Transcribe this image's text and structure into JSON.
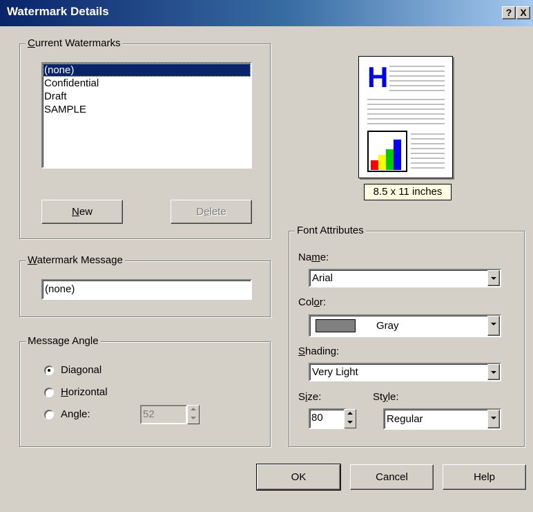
{
  "window": {
    "title": "Watermark Details",
    "help_btn": "?",
    "close_btn": "X"
  },
  "current_watermarks": {
    "legend": "Current Watermarks",
    "items": [
      "(none)",
      "Confidential",
      "Draft",
      "SAMPLE"
    ],
    "selected_index": 0,
    "new_button": "New",
    "delete_button": "Delete"
  },
  "watermark_message": {
    "legend": "Watermark Message",
    "value": "(none)"
  },
  "message_angle": {
    "legend": "Message Angle",
    "options": [
      "Diagonal",
      "Horizontal",
      "Angle:"
    ],
    "selected": "Diagonal",
    "angle_value": "52"
  },
  "preview": {
    "size_label": "8.5 x 11 inches",
    "heading_glyph": "H"
  },
  "font_attributes": {
    "legend": "Font Attributes",
    "name_label": "Name:",
    "name_value": "Arial",
    "color_label": "Color:",
    "color_value": "Gray",
    "color_swatch": "#808080",
    "shading_label": "Shading:",
    "shading_value": "Very Light",
    "size_label": "Size:",
    "size_value": "80",
    "style_label": "Style:",
    "style_value": "Regular"
  },
  "buttons": {
    "ok": "OK",
    "cancel": "Cancel",
    "help": "Help"
  },
  "colors": {
    "title_bar": "#0a246a",
    "face": "#d4d0c8",
    "selection": "#0a246a",
    "preview_h": "#0000ff"
  }
}
